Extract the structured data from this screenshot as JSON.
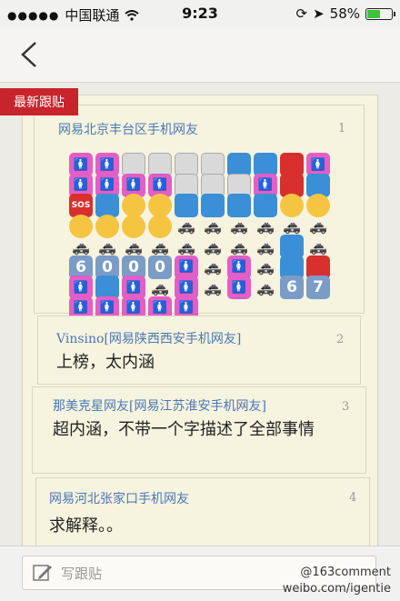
{
  "status_bar": {
    "carrier": "中国联通",
    "time": "9:23",
    "battery": "58%",
    "battery_level": 0.58
  },
  "ribbon": {
    "label": "最新跟贴"
  },
  "posts": [
    {
      "user": "网易北京丰台区手机网友",
      "floor": "1",
      "emoji_rows": [
        [
          "person",
          "person",
          "bldg",
          "bldg",
          "bldg",
          "bldg",
          "blue",
          "blue",
          "red",
          "person"
        ],
        [
          "person",
          "person",
          "person",
          "person",
          "bldg",
          "bldg",
          "bldg",
          "person",
          "red",
          "blue"
        ],
        [
          "sos",
          "blue",
          "face",
          "face",
          "blue",
          "blue",
          "blue",
          "blue",
          "face",
          "face"
        ],
        [
          "face",
          "face",
          "face",
          "face",
          "car",
          "car",
          "car",
          "car",
          "car",
          "car"
        ],
        [
          "car",
          "car",
          "car",
          "car",
          "car",
          "car",
          "car",
          "car",
          "blue",
          "car"
        ],
        [
          "num:6",
          "num:0",
          "num:0",
          "num:0",
          "person",
          "car",
          "person",
          "car",
          "blue",
          "red"
        ],
        [
          "person",
          "blue",
          "person",
          "car",
          "person",
          "car",
          "person",
          "car",
          "num:6",
          "num:7"
        ],
        [
          "person",
          "person",
          "person",
          "person",
          "person"
        ]
      ]
    },
    {
      "user": "Vinsino[网易陕西西安手机网友]",
      "floor": "2",
      "text": "上榜，太内涵"
    },
    {
      "user": "那美克星网友[网易江苏淮安手机网友]",
      "floor": "3",
      "text": "超内涵，不带一个字描述了全部事情"
    },
    {
      "user": "网易河北张家口手机网友",
      "floor": "4",
      "text": "求解释。。"
    }
  ],
  "compose": {
    "placeholder": "写跟贴"
  },
  "watermark": {
    "line1": "@163comment",
    "line2": "weibo.com/igentie"
  }
}
